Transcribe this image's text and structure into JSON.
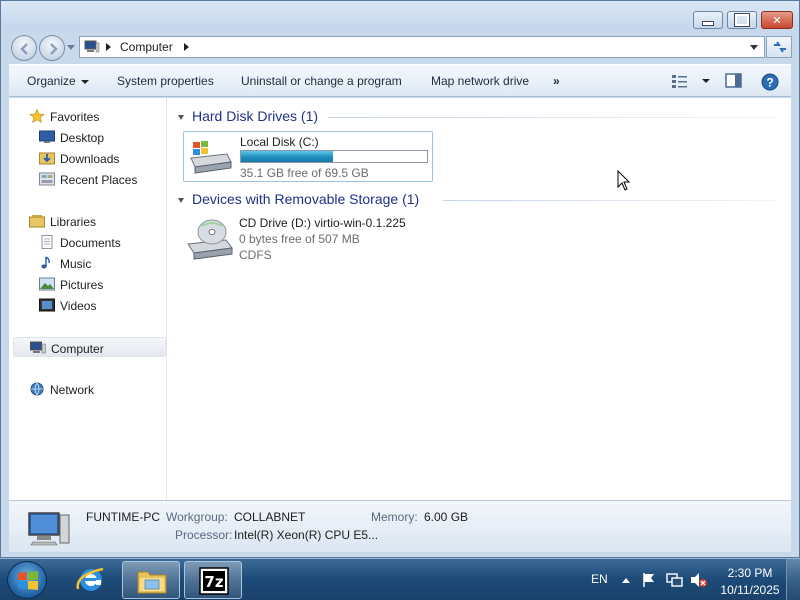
{
  "window": {
    "title": "Computer",
    "address": "Computer",
    "controls": {
      "minimize": "minimize",
      "maximize": "maximize",
      "close": "close"
    }
  },
  "commandbar": {
    "organize": "Organize",
    "system_properties": "System properties",
    "uninstall": "Uninstall or change a program",
    "map_drive": "Map network drive",
    "more": "»"
  },
  "navpane": {
    "favorites": "Favorites",
    "desktop": "Desktop",
    "downloads": "Downloads",
    "recent": "Recent Places",
    "libraries": "Libraries",
    "documents": "Documents",
    "music": "Music",
    "pictures": "Pictures",
    "videos": "Videos",
    "computer": "Computer",
    "network": "Network"
  },
  "groups": {
    "hdd_header": "Hard Disk Drives (1)",
    "removable_header": "Devices with Removable Storage (1)"
  },
  "drives": {
    "local": {
      "name": "Local Disk (C:)",
      "free": "35.1 GB free of 69.5 GB",
      "used_fraction": 0.495
    },
    "cd": {
      "name": "CD Drive (D:) virtio-win-0.1.225",
      "free": "0 bytes free of 507 MB",
      "fs": "CDFS"
    }
  },
  "details": {
    "pc_name": "FUNTIME-PC",
    "workgroup_label": "Workgroup:",
    "workgroup": "COLLABNET",
    "memory_label": "Memory:",
    "memory": "6.00 GB",
    "processor_label": "Processor:",
    "processor": "Intel(R) Xeon(R) CPU E5..."
  },
  "taskbar": {
    "lang": "EN",
    "time": "2:30 PM",
    "date": "10/11/2025"
  },
  "colors": {
    "accent": "#1e3287",
    "selection": "#9cc3e6",
    "bar_fill": "#1f8fbf",
    "taskbar": "#1d4a78"
  }
}
